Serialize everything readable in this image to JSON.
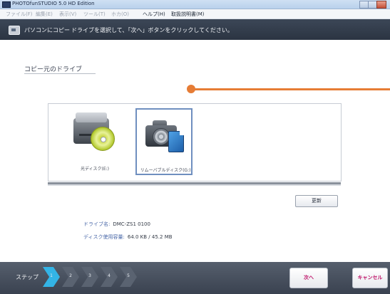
{
  "window": {
    "title": "PHOTOfunSTUDIO 5.0 HD Edition"
  },
  "menu": {
    "items": [
      "ファイル(F)",
      "編集(E)",
      "表示(V)",
      "ツール(T)",
      "ホカ(O)",
      "ヘルプ(H)",
      "取扱説明書(M)"
    ],
    "active_index": 5
  },
  "header": {
    "title": "パソコンにコピー",
    "instruction": "ドライブを選択して、「次へ」ボタンをクリックしてください。"
  },
  "main": {
    "section_title": "コピー元のドライブ",
    "drives": [
      {
        "label": "光ディスク(E:)",
        "icon": "optical-disk-drive-icon",
        "selected": false
      },
      {
        "label": "リムーバブルディスク(G:)",
        "icon": "removable-camera-disk-icon",
        "selected": true
      }
    ],
    "refresh_label": "更新",
    "drive_name_label": "ドライブ名:",
    "drive_name_value": "DMC-ZS1 0100",
    "disk_usage_label": "ディスク使用容量:",
    "disk_usage_value": "64.0 KB / 45.2 MB"
  },
  "footer": {
    "step_label": "ステップ",
    "steps": [
      "1",
      "2",
      "3",
      "4",
      "5"
    ],
    "active_step": 1,
    "next_label": "次へ",
    "cancel_label": "キャンセル"
  },
  "colors": {
    "header_bg": "#2f3846",
    "active_step": "#33b4e6",
    "callout": "#e67c35",
    "button_text": "#c0166a"
  }
}
